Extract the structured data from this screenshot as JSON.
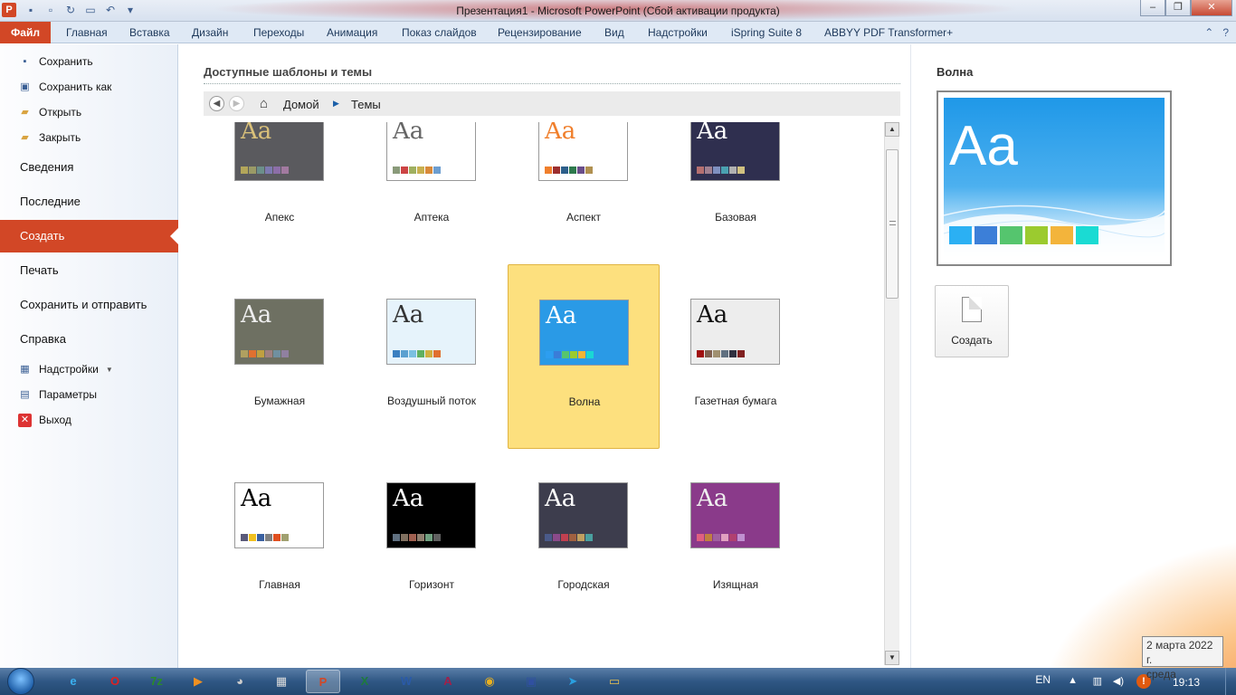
{
  "window": {
    "title": "Презентация1  -  Microsoft PowerPoint (Сбой активации продукта)",
    "app_icon": "P"
  },
  "ribbon": {
    "file_tab": "Файл",
    "tabs": [
      "Главная",
      "Вставка",
      "Дизайн",
      "Переходы",
      "Анимация",
      "Показ слайдов",
      "Рецензирование",
      "Вид",
      "Надстройки",
      "iSpring Suite 8",
      "ABBYY PDF Transformer+"
    ]
  },
  "backstage": {
    "small_top": [
      {
        "label": "Сохранить",
        "icon": "save-icon"
      },
      {
        "label": "Сохранить как",
        "icon": "save-as-icon"
      },
      {
        "label": "Открыть",
        "icon": "open-folder-icon"
      },
      {
        "label": "Закрыть",
        "icon": "close-folder-icon"
      }
    ],
    "big": [
      "Сведения",
      "Последние",
      "Создать",
      "Печать",
      "Сохранить и отправить",
      "Справка"
    ],
    "active": "Создать",
    "small_bottom": [
      {
        "label": "Надстройки",
        "icon": "addins-icon"
      },
      {
        "label": "Параметры",
        "icon": "options-icon"
      },
      {
        "label": "Выход",
        "icon": "exit-icon"
      }
    ]
  },
  "main": {
    "heading": "Доступные шаблоны и темы",
    "breadcrumb_home": "Домой",
    "breadcrumb_current": "Темы",
    "themes": [
      {
        "name": "Апекс",
        "bg": "#5a5a5e",
        "aa_color": "#d9c07a",
        "swatches": [
          "#b3a65a",
          "#9a9a66",
          "#6b8f8a",
          "#7d7ab0",
          "#8c6ea8",
          "#a27aa0"
        ]
      },
      {
        "name": "Аптека",
        "bg": "#ffffff",
        "aa_color": "#666666",
        "swatches": [
          "#8a9a7a",
          "#c44",
          "#a0b060",
          "#c9b050",
          "#d98a3a",
          "#6d9ed0"
        ]
      },
      {
        "name": "Аспект",
        "bg": "#ffffff",
        "aa_color": "#f07f2c",
        "swatches": [
          "#f07f2c",
          "#9c2e2e",
          "#2d5f8a",
          "#2e7a4d",
          "#6a4e8a",
          "#b09050"
        ]
      },
      {
        "name": "Базовая",
        "bg": "#2f2f4f",
        "aa_color": "#ffffff",
        "swatches": [
          "#b57070",
          "#a08090",
          "#7f90c0",
          "#4aa0b0",
          "#b0b0b0",
          "#d0c080"
        ]
      },
      {
        "name": "Бумажная",
        "bg": "#6e7062",
        "aa_color": "#eeeeee",
        "swatches": [
          "#b0a060",
          "#e07030",
          "#c0a040",
          "#a08080",
          "#7090a0",
          "#9080a0"
        ]
      },
      {
        "name": "Воздушный поток",
        "bg": "#e6f3fb",
        "aa_color": "#333333",
        "swatches": [
          "#3a7fc0",
          "#5aa0d0",
          "#7ac0e0",
          "#60b060",
          "#d0b040",
          "#e07030"
        ]
      },
      {
        "name": "Волна",
        "bg": "#2a9ae6",
        "aa_color": "#ffffff",
        "swatches": [
          "#2d9ef0",
          "#3a7dd8",
          "#56c56e",
          "#9acb2f",
          "#f3b435",
          "#1ad7d4"
        ]
      },
      {
        "name": "Газетная бумага",
        "bg": "#ededed",
        "aa_color": "#111111",
        "swatches": [
          "#a01010",
          "#806050",
          "#a09070",
          "#607080",
          "#303040",
          "#802020"
        ]
      },
      {
        "name": "Главная",
        "bg": "#ffffff",
        "aa_color": "#000000",
        "swatches": [
          "#5a5a7a",
          "#f0c020",
          "#3a60a0",
          "#808080",
          "#e05020",
          "#a0a070"
        ]
      },
      {
        "name": "Горизонт",
        "bg": "#000000",
        "aa_color": "#ffffff",
        "swatches": [
          "#607080",
          "#807060",
          "#a06050",
          "#908070",
          "#70a080",
          "#606060"
        ]
      },
      {
        "name": "Городская",
        "bg": "#3d3d4d",
        "aa_color": "#ffffff",
        "swatches": [
          "#4a5a8a",
          "#8a4a8a",
          "#c04050",
          "#a06040",
          "#c0a060",
          "#4aa0a0"
        ]
      },
      {
        "name": "Изящная",
        "bg": "#8a3a8a",
        "aa_color": "#eeeeee",
        "swatches": [
          "#e06080",
          "#c08040",
          "#a060a0",
          "#e0a0c0",
          "#b04070",
          "#c090d0"
        ]
      }
    ],
    "selected": "Волна"
  },
  "preview": {
    "title": "Волна",
    "aa": "Aa",
    "swatches": [
      "#2bb0f3",
      "#3c7fd8",
      "#55c56e",
      "#9bcb2f",
      "#f3b43b",
      "#1adbd3"
    ],
    "create_label": "Создать"
  },
  "thumb_aa": "Aa",
  "taskbar": {
    "apps": [
      {
        "name": "ie",
        "glyph": "e",
        "color": "#3ab0f0"
      },
      {
        "name": "opera",
        "glyph": "O",
        "color": "#e02020"
      },
      {
        "name": "7zip",
        "glyph": "7z",
        "color": "#2a8a2a"
      },
      {
        "name": "media",
        "glyph": "▶",
        "color": "#f09020"
      },
      {
        "name": "gimp",
        "glyph": "◕",
        "color": "#cccccc"
      },
      {
        "name": "calc",
        "glyph": "▦",
        "color": "#dddddd"
      },
      {
        "name": "powerpoint",
        "glyph": "P",
        "color": "#d24726"
      },
      {
        "name": "excel",
        "glyph": "X",
        "color": "#1e7a3c"
      },
      {
        "name": "word",
        "glyph": "W",
        "color": "#2a5aa8"
      },
      {
        "name": "access",
        "glyph": "A",
        "color": "#a0204a"
      },
      {
        "name": "chrome",
        "glyph": "◉",
        "color": "#e8b020"
      },
      {
        "name": "save",
        "glyph": "▣",
        "color": "#3050a0"
      },
      {
        "name": "telegram",
        "glyph": "➤",
        "color": "#2aa0e0"
      },
      {
        "name": "explorer",
        "glyph": "▭",
        "color": "#e8c050"
      }
    ],
    "active_app": "powerpoint",
    "lang": "EN",
    "time": "19:13",
    "tooltip_date": "2 марта 2022 г.",
    "tooltip_day": "среда"
  }
}
